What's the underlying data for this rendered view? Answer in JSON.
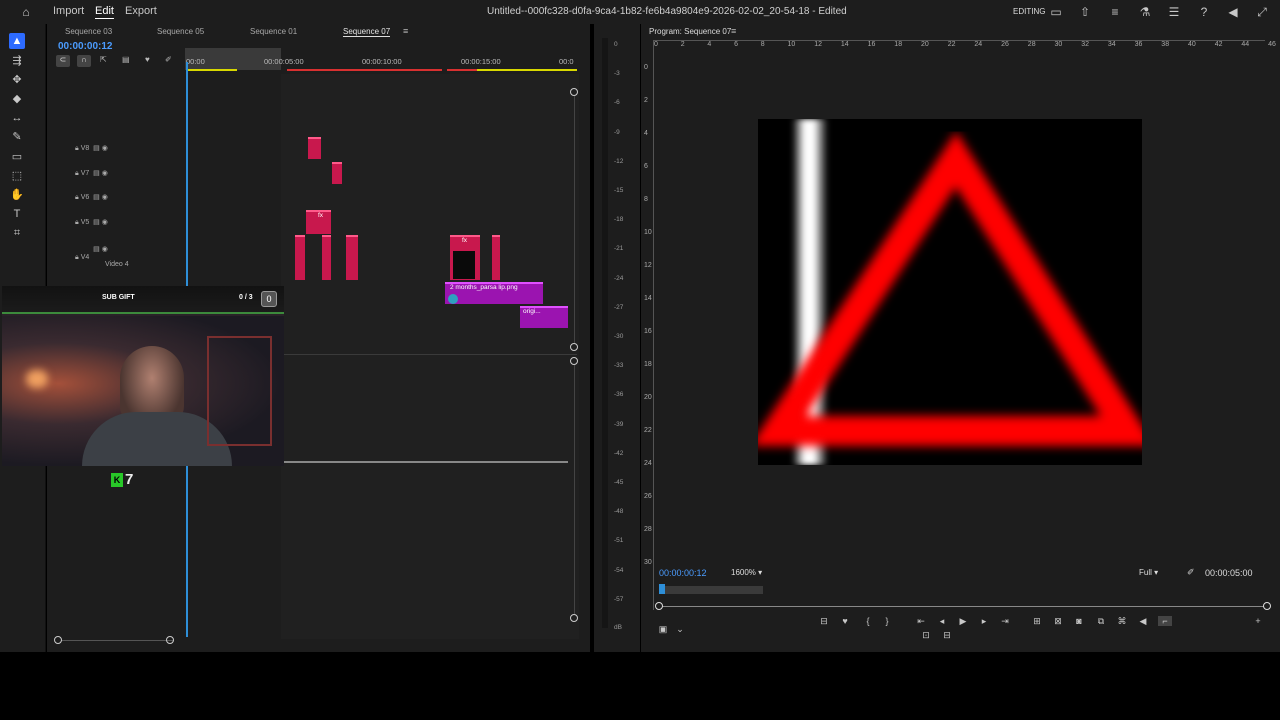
{
  "topbar": {
    "menus": [
      "Import",
      "Edit",
      "Export"
    ],
    "title": "Untitled--000fc328-d0fa-9ca4-1b82-fe6b4a9804e9-2026-02-02_20-54-18 - Edited",
    "workspace": "EDITING"
  },
  "timeline": {
    "tabs": [
      "Sequence 03",
      "Sequence 05",
      "Sequence 01",
      "Sequence 07"
    ],
    "timecode": "00:00:00:12",
    "ruler": [
      "00:00",
      "00:00:05:00",
      "00:00:10:00",
      "00:00:15:00",
      "00:0"
    ],
    "tracks": [
      {
        "name": "V8",
        "label": ""
      },
      {
        "name": "V7",
        "label": ""
      },
      {
        "name": "V6",
        "label": ""
      },
      {
        "name": "V5",
        "label": ""
      },
      {
        "name": "V4",
        "label": "Video 4"
      }
    ],
    "clips": {
      "png_clip": "2 months_parsa lip.png",
      "orig_clip": "origi...",
      "fx": "fx"
    }
  },
  "meter": {
    "db_labels": [
      "0",
      "-3",
      "-6",
      "-9",
      "-12",
      "-15",
      "-18",
      "-21",
      "-24",
      "-27",
      "-30",
      "-33",
      "-36",
      "-39",
      "-42",
      "-45",
      "-48",
      "-51",
      "-54",
      "-57",
      "dB"
    ]
  },
  "program": {
    "title": "Program: Sequence 07",
    "h_ruler": [
      "0",
      "2",
      "4",
      "6",
      "8",
      "10",
      "12",
      "14",
      "16",
      "18",
      "20",
      "22",
      "24",
      "26",
      "28",
      "30",
      "32",
      "34",
      "36",
      "38",
      "40",
      "42",
      "44",
      "46"
    ],
    "v_ruler": [
      "0",
      "2",
      "4",
      "6",
      "8",
      "10",
      "12",
      "14",
      "16",
      "18",
      "20",
      "22",
      "24",
      "26",
      "28",
      "30"
    ],
    "timecode": "00:00:00:12",
    "zoom": "1600%",
    "quality": "Full",
    "duration": "00:00:05:00"
  },
  "overlay": {
    "sub_label": "SUB GIFT",
    "sub_count": "0 / 3",
    "sub_icon": "0",
    "badge_number": "7",
    "badge_letter": "K"
  }
}
